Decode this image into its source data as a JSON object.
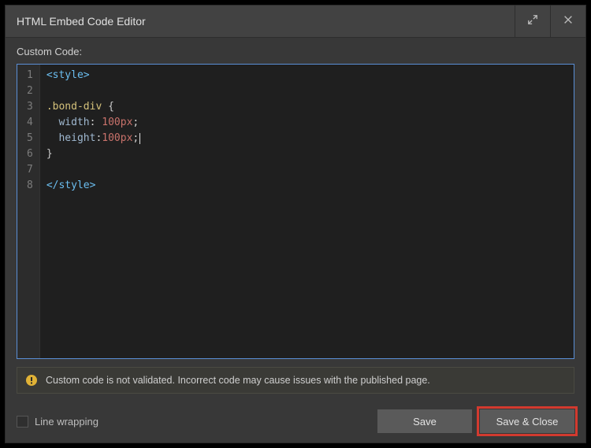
{
  "header": {
    "title": "HTML Embed Code Editor"
  },
  "labels": {
    "custom_code": "Custom Code:"
  },
  "editor": {
    "line_count": 8,
    "code_lines": [
      {
        "num": 1,
        "tokens": [
          {
            "t": "<style>",
            "c": "tok-tag"
          }
        ]
      },
      {
        "num": 2,
        "tokens": []
      },
      {
        "num": 3,
        "tokens": [
          {
            "t": ".bond-div ",
            "c": "tok-sel"
          },
          {
            "t": "{",
            "c": "tok-brace"
          }
        ]
      },
      {
        "num": 4,
        "tokens": [
          {
            "t": "  ",
            "c": ""
          },
          {
            "t": "width",
            "c": "tok-prop"
          },
          {
            "t": ": ",
            "c": "tok-punct"
          },
          {
            "t": "100px",
            "c": "tok-val"
          },
          {
            "t": ";",
            "c": "tok-punct"
          }
        ]
      },
      {
        "num": 5,
        "tokens": [
          {
            "t": "  ",
            "c": ""
          },
          {
            "t": "height",
            "c": "tok-prop"
          },
          {
            "t": ":",
            "c": "tok-punct"
          },
          {
            "t": "100px",
            "c": "tok-val"
          },
          {
            "t": ";",
            "c": "tok-punct"
          }
        ],
        "caret_after": true
      },
      {
        "num": 6,
        "tokens": [
          {
            "t": "}",
            "c": "tok-brace"
          }
        ]
      },
      {
        "num": 7,
        "tokens": []
      },
      {
        "num": 8,
        "tokens": [
          {
            "t": "</style>",
            "c": "tok-tag"
          }
        ]
      }
    ]
  },
  "warning": {
    "text": "Custom code is not validated. Incorrect code may cause issues with the published page."
  },
  "footer": {
    "line_wrapping_label": "Line wrapping",
    "save_label": "Save",
    "save_close_label": "Save & Close"
  }
}
